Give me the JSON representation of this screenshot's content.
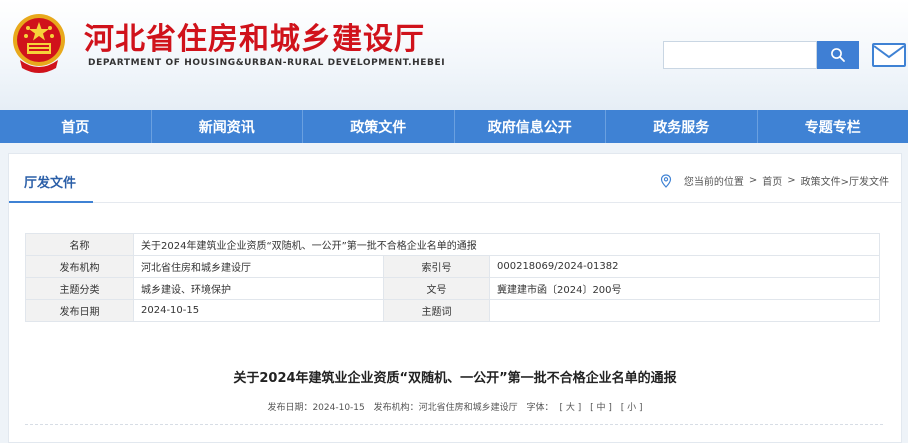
{
  "site": {
    "title_cn": "河北省住房和城乡建设厅",
    "title_en": "DEPARTMENT OF HOUSING&URBAN-RURAL DEVELOPMENT.HEBEI",
    "brand_red": "#d0121b",
    "accent_blue": "#3f82d4"
  },
  "search": {
    "placeholder": "",
    "button_icon": "search-icon",
    "mail_icon": "mail-icon"
  },
  "nav": {
    "items": [
      {
        "label": "首页"
      },
      {
        "label": "新闻资讯"
      },
      {
        "label": "政策文件"
      },
      {
        "label": "政府信息公开"
      },
      {
        "label": "政务服务"
      },
      {
        "label": "专题专栏"
      }
    ]
  },
  "section": {
    "title": "厅发文件"
  },
  "breadcrumb": {
    "prefix": "您当前的位置",
    "sep": ">",
    "home": "首页",
    "current": "政策文件>厅发文件"
  },
  "info": {
    "name_label": "名称",
    "name_value": "关于2024年建筑业企业资质“双随机、一公开”第一批不合格企业名单的通报",
    "publisher_label": "发布机构",
    "publisher_value": "河北省住房和城乡建设厅",
    "index_label": "索引号",
    "index_value": "000218069/2024-01382",
    "topic_label": "主题分类",
    "topic_value": "城乡建设、环境保护",
    "docno_label": "文号",
    "docno_value": "冀建建市函〔2024〕200号",
    "date_label": "发布日期",
    "date_value": "2024-10-15",
    "keyword_label": "主题词",
    "keyword_value": ""
  },
  "article": {
    "title": "关于2024年建筑业企业资质“双随机、一公开”第一批不合格企业名单的通报",
    "meta_date": "发布日期：2024-10-15",
    "meta_org": "发布机构：河北省住房和城乡建设厅",
    "font_label": "字体：",
    "font_large": "[ 大 ]",
    "font_medium": "[ 中 ]",
    "font_small": "[ 小 ]"
  }
}
